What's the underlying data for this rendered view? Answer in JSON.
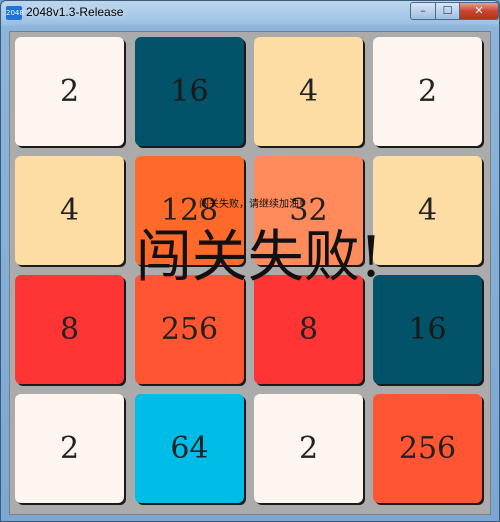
{
  "window": {
    "title": "2048v1.3-Release",
    "icon_text": "2048",
    "controls": {
      "minimize": "–",
      "maximize": "☐",
      "close": "✕"
    }
  },
  "colors": {
    "bg_2": "#fdf5f0",
    "bg_4": "#fddda3",
    "bg_8": "#ff3535",
    "bg_16": "#02536a",
    "bg_32": "#ff8a5c",
    "bg_64": "#00bde8",
    "bg_128": "#ff6a2a",
    "bg_256": "#ff5533"
  },
  "board": {
    "tiles": [
      [
        "2",
        "16",
        "4",
        "2"
      ],
      [
        "4",
        "128",
        "32",
        "4"
      ],
      [
        "8",
        "256",
        "8",
        "16"
      ],
      [
        "2",
        "64",
        "2",
        "256"
      ]
    ]
  },
  "overlay": {
    "small_message": "闯关失败，请继续加油!",
    "big_message": "闯关失败!"
  }
}
